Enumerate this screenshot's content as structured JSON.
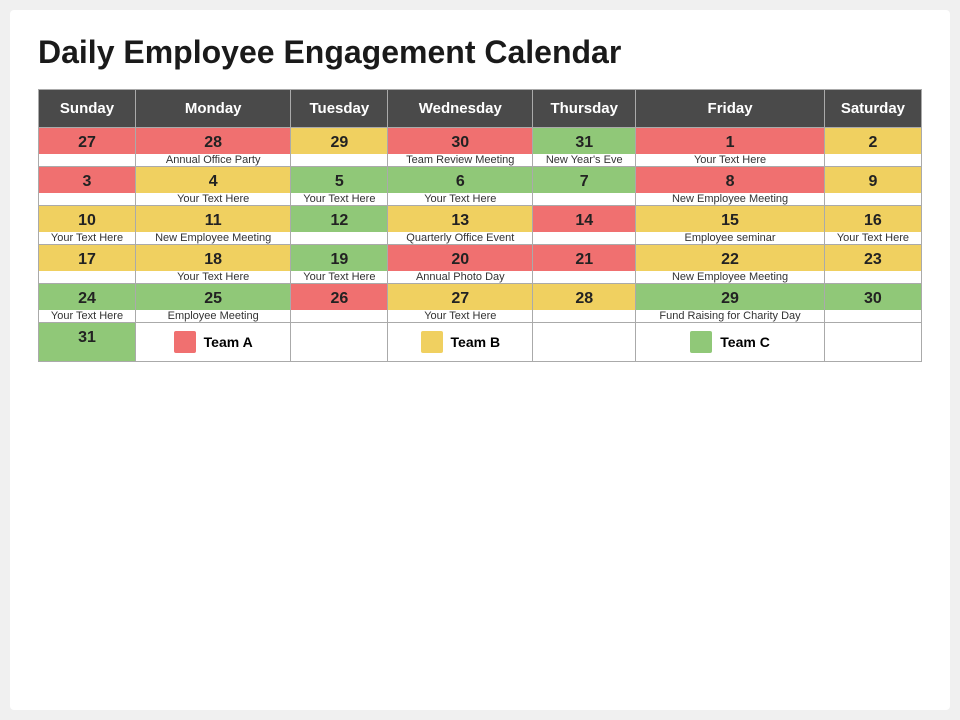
{
  "title": "Daily Employee Engagement Calendar",
  "headers": [
    "Sunday",
    "Monday",
    "Tuesday",
    "Wednesday",
    "Thursday",
    "Friday",
    "Saturday"
  ],
  "weeks": [
    {
      "dates": [
        {
          "num": "27",
          "color": "bg-red"
        },
        {
          "num": "28",
          "color": "bg-red"
        },
        {
          "num": "29",
          "color": "bg-yellow"
        },
        {
          "num": "30",
          "color": "bg-red"
        },
        {
          "num": "31",
          "color": "bg-green"
        },
        {
          "num": "1",
          "color": "bg-red"
        },
        {
          "num": "2",
          "color": "bg-yellow"
        }
      ],
      "events": [
        "",
        "Annual Office Party",
        "",
        "Team Review Meeting",
        "New Year's Eve",
        "Your Text Here",
        ""
      ]
    },
    {
      "dates": [
        {
          "num": "3",
          "color": "bg-red"
        },
        {
          "num": "4",
          "color": "bg-yellow"
        },
        {
          "num": "5",
          "color": "bg-green"
        },
        {
          "num": "6",
          "color": "bg-green"
        },
        {
          "num": "7",
          "color": "bg-green"
        },
        {
          "num": "8",
          "color": "bg-red"
        },
        {
          "num": "9",
          "color": "bg-yellow"
        }
      ],
      "events": [
        "",
        "Your Text Here",
        "Your Text Here",
        "Your Text Here",
        "",
        "New Employee Meeting",
        ""
      ]
    },
    {
      "dates": [
        {
          "num": "10",
          "color": "bg-yellow"
        },
        {
          "num": "11",
          "color": "bg-yellow"
        },
        {
          "num": "12",
          "color": "bg-green"
        },
        {
          "num": "13",
          "color": "bg-yellow"
        },
        {
          "num": "14",
          "color": "bg-red"
        },
        {
          "num": "15",
          "color": "bg-yellow"
        },
        {
          "num": "16",
          "color": "bg-yellow"
        }
      ],
      "events": [
        "Your Text Here",
        "New Employee Meeting",
        "",
        "Quarterly Office Event",
        "",
        "Employee seminar",
        "Your Text Here"
      ]
    },
    {
      "dates": [
        {
          "num": "17",
          "color": "bg-yellow"
        },
        {
          "num": "18",
          "color": "bg-yellow"
        },
        {
          "num": "19",
          "color": "bg-green"
        },
        {
          "num": "20",
          "color": "bg-red"
        },
        {
          "num": "21",
          "color": "bg-red"
        },
        {
          "num": "22",
          "color": "bg-yellow"
        },
        {
          "num": "23",
          "color": "bg-yellow"
        }
      ],
      "events": [
        "",
        "Your Text Here",
        "Your Text Here",
        "Annual Photo Day",
        "",
        "New Employee Meeting",
        ""
      ]
    },
    {
      "dates": [
        {
          "num": "24",
          "color": "bg-green"
        },
        {
          "num": "25",
          "color": "bg-green"
        },
        {
          "num": "26",
          "color": "bg-red"
        },
        {
          "num": "27",
          "color": "bg-yellow"
        },
        {
          "num": "28",
          "color": "bg-yellow"
        },
        {
          "num": "29",
          "color": "bg-green"
        },
        {
          "num": "30",
          "color": "bg-green"
        }
      ],
      "events": [
        "Your Text Here",
        "Employee Meeting",
        "",
        "Your Text Here",
        "",
        "Fund Raising for Charity Day",
        ""
      ]
    }
  ],
  "last_date": {
    "num": "31",
    "color": "bg-green"
  },
  "legend": [
    {
      "label": "Team A",
      "color": "lb-red"
    },
    {
      "label": "Team B",
      "color": "lb-yellow"
    },
    {
      "label": "Team C",
      "color": "lb-green"
    }
  ]
}
